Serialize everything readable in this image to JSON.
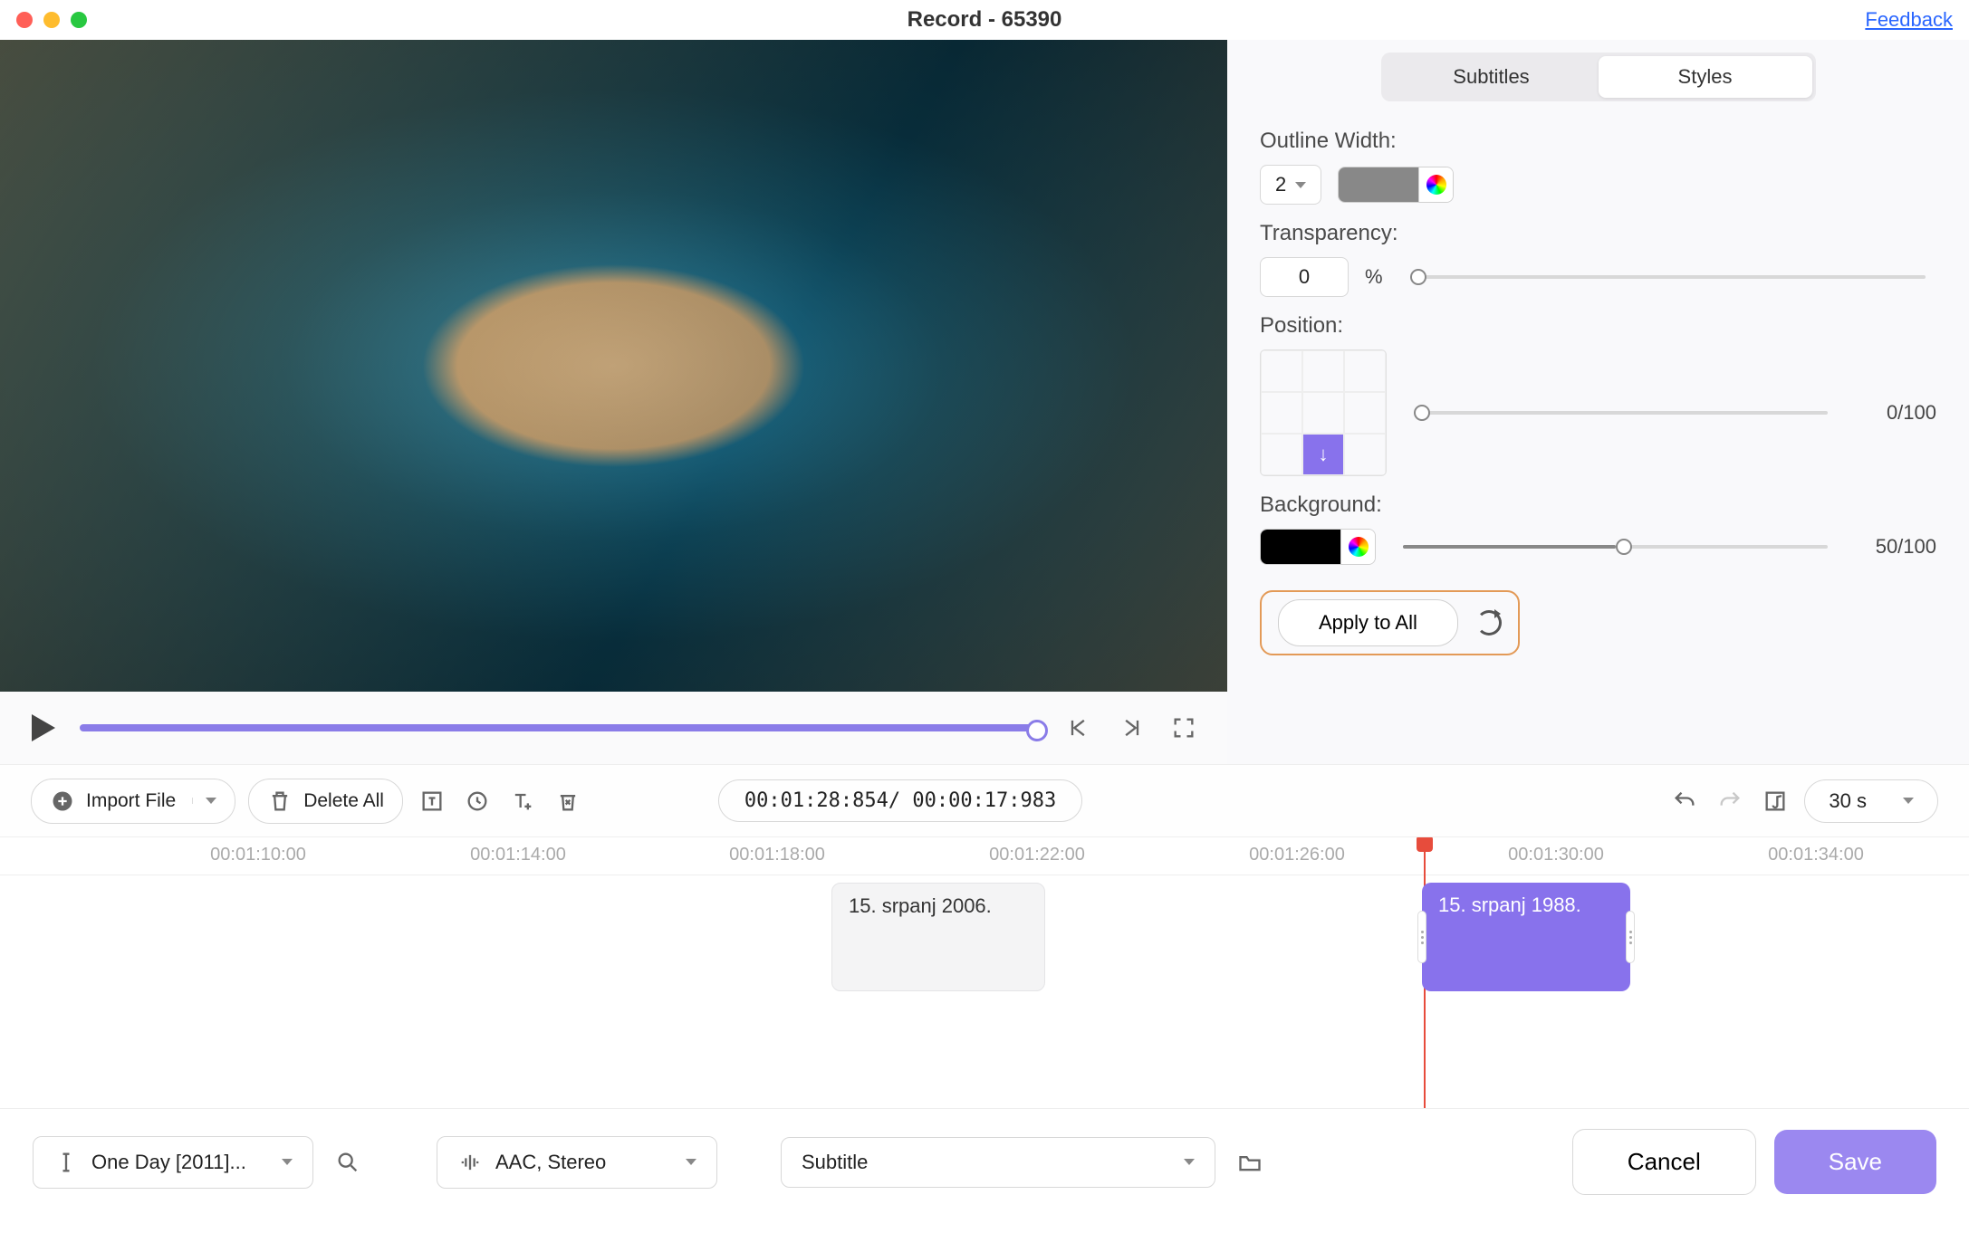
{
  "header": {
    "title": "Record - 65390",
    "feedback": "Feedback"
  },
  "tabs": {
    "subtitles": "Subtitles",
    "styles": "Styles"
  },
  "styles": {
    "outline_label": "Outline Width:",
    "outline_value": "2",
    "transparency_label": "Transparency:",
    "transparency_value": "0",
    "percent": "%",
    "position_label": "Position:",
    "position_ratio": "0/100",
    "background_label": "Background:",
    "background_ratio": "50/100",
    "apply_all": "Apply to All"
  },
  "toolbar": {
    "import": "Import File",
    "delete_all": "Delete All",
    "time": "00:01:28:854/ 00:00:17:983",
    "zoom": "30 s"
  },
  "timeline": {
    "labels": [
      "00:01:10:00",
      "00:01:14:00",
      "00:01:18:00",
      "00:01:22:00",
      "00:01:26:00",
      "00:01:30:00",
      "00:01:34:00"
    ],
    "clip1": "15. srpanj 2006.",
    "clip2": "15. srpanj 1988."
  },
  "footer": {
    "file": "One Day [2011]...",
    "audio": "AAC, Stereo",
    "track": "Subtitle",
    "cancel": "Cancel",
    "save": "Save"
  }
}
